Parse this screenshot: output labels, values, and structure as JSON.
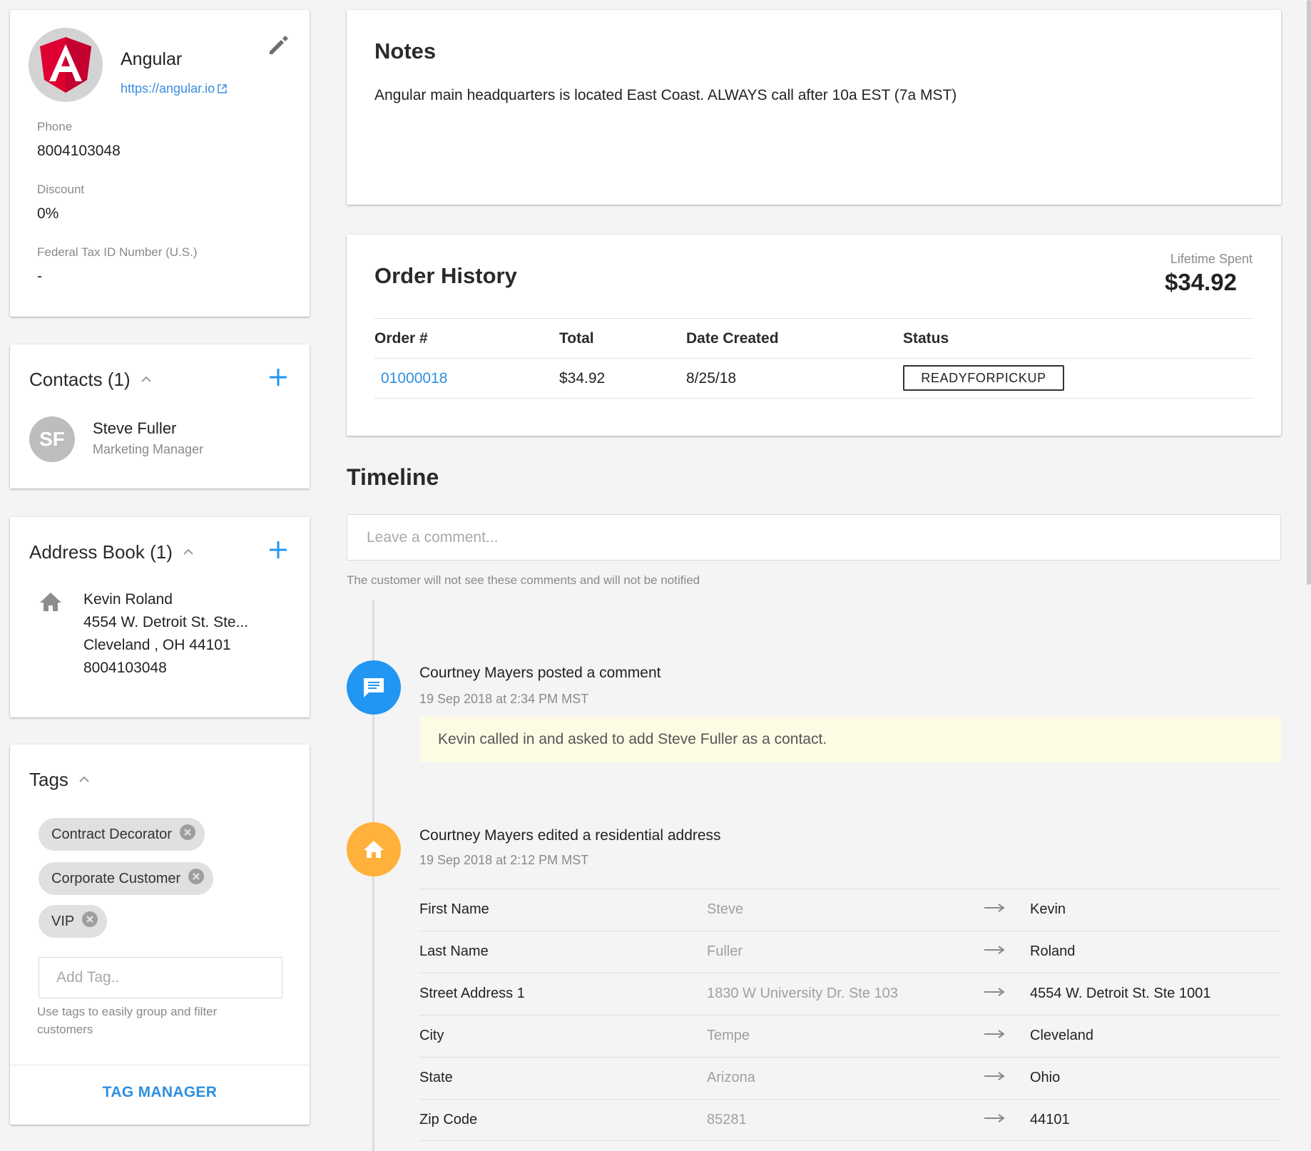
{
  "company": {
    "name": "Angular",
    "url": "https://angular.io",
    "fields": [
      {
        "label": "Phone",
        "value": "8004103048"
      },
      {
        "label": "Discount",
        "value": "0%"
      },
      {
        "label": "Federal Tax ID Number (U.S.)",
        "value": "-"
      }
    ]
  },
  "contacts": {
    "title": "Contacts (1)",
    "items": [
      {
        "initials": "SF",
        "name": "Steve Fuller",
        "role": "Marketing Manager"
      }
    ]
  },
  "address_book": {
    "title": "Address Book (1)",
    "entry": {
      "name": "Kevin Roland",
      "street": "4554 W. Detroit St. Ste...",
      "city_line": "Cleveland , OH 44101",
      "phone": "8004103048"
    }
  },
  "tags": {
    "title": "Tags",
    "items": [
      "Contract Decorator",
      "Corporate Customer",
      "VIP"
    ],
    "input_placeholder": "Add Tag..",
    "hint": "Use tags to easily group and filter customers",
    "manager_label": "TAG MANAGER"
  },
  "notes": {
    "title": "Notes",
    "text": "Angular main headquarters is located East Coast. ALWAYS call after 10a EST (7a MST)"
  },
  "order_history": {
    "title": "Order History",
    "lifetime_label": "Lifetime Spent",
    "lifetime_value": "$34.92",
    "columns": [
      "Order #",
      "Total",
      "Date Created",
      "Status"
    ],
    "rows": [
      {
        "order": "01000018",
        "total": "$34.92",
        "date": "8/25/18",
        "status": "READYFORPICKUP"
      }
    ]
  },
  "timeline": {
    "title": "Timeline",
    "comment_placeholder": "Leave a comment...",
    "comment_hint": "The customer will not see these comments and will not be notified",
    "events": [
      {
        "icon": "comment-icon",
        "title": "Courtney Mayers posted a comment",
        "time": "19 Sep 2018 at 2:34 PM MST",
        "comment": "Kevin called in and asked to add Steve Fuller as a contact."
      },
      {
        "icon": "home-icon",
        "title": "Courtney Mayers edited a residential address",
        "time": "19 Sep 2018 at 2:12 PM MST",
        "changes": [
          {
            "field": "First Name",
            "old": "Steve",
            "new": "Kevin"
          },
          {
            "field": "Last Name",
            "old": "Fuller",
            "new": "Roland"
          },
          {
            "field": "Street Address 1",
            "old": "1830 W University Dr. Ste 103",
            "new": "4554 W. Detroit St. Ste 1001"
          },
          {
            "field": "City",
            "old": "Tempe",
            "new": "Cleveland"
          },
          {
            "field": "State",
            "old": "Arizona",
            "new": "Ohio"
          },
          {
            "field": "Zip Code",
            "old": "85281",
            "new": "44101"
          }
        ]
      }
    ]
  },
  "colors": {
    "accent_blue": "#2196f3",
    "link_blue": "#2e8fe0",
    "angular_red": "#dd0031",
    "timeline_orange": "#ffb13b",
    "comment_bg": "#fdfbe4"
  }
}
